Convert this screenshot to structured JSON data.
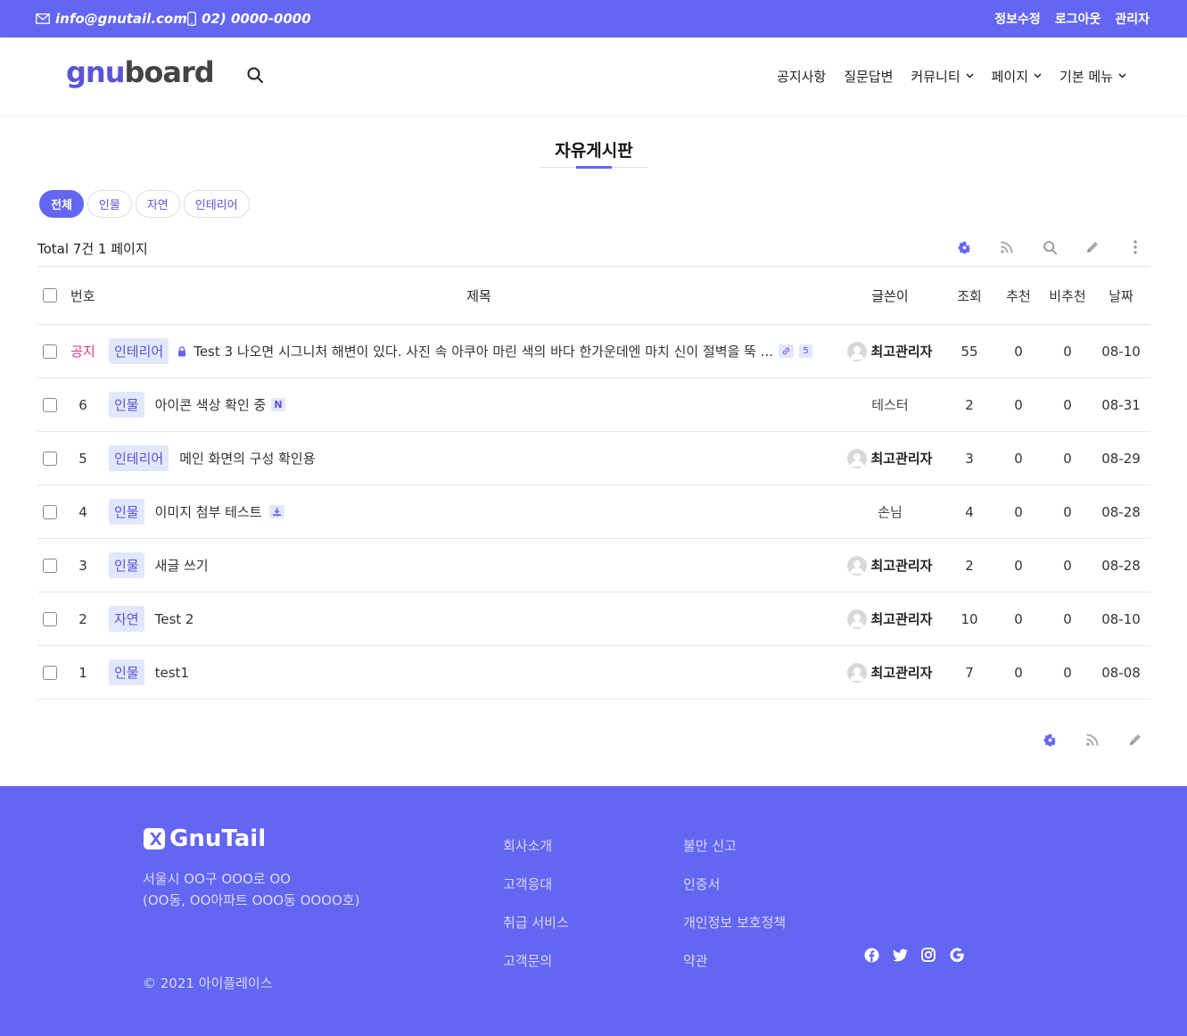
{
  "topbar": {
    "email": "info@gnutail.com",
    "phone": "02) 0000-0000",
    "links": [
      "정보수정",
      "로그아웃",
      "관리자"
    ]
  },
  "header": {
    "logo_part1": "gnu",
    "logo_part2": "board",
    "nav": [
      {
        "label": "공지사항",
        "dropdown": false
      },
      {
        "label": "질문답변",
        "dropdown": false
      },
      {
        "label": "커뮤니티",
        "dropdown": true
      },
      {
        "label": "페이지",
        "dropdown": true
      },
      {
        "label": "기본 메뉴",
        "dropdown": true
      }
    ]
  },
  "board": {
    "title": "자유게시판",
    "categories": [
      "전체",
      "인물",
      "자연",
      "인테리어"
    ],
    "active_category": "전체",
    "total_text": "Total 7건 1 페이지",
    "columns": {
      "num": "번호",
      "subject": "제목",
      "writer": "글쓴이",
      "hit": "조회",
      "good": "추천",
      "nogood": "비추천",
      "date": "날짜"
    },
    "rows": [
      {
        "num": "공지",
        "notice": true,
        "category": "인테리어",
        "subject": "Test 3 나오면 시그니처 해변이 있다. 사진 속 아쿠아 마린 색의 바다 한가운데엔 마치 신이 절벽을 뚝 ...",
        "secret": true,
        "link": true,
        "comments": "5",
        "writer": "최고관리자",
        "avatar": true,
        "hit": "55",
        "good": "0",
        "nogood": "0",
        "date": "08-10"
      },
      {
        "num": "6",
        "category": "인물",
        "subject": "아이콘 색상 확인 중",
        "new_badge": "N",
        "writer": "테스터",
        "avatar": false,
        "hit": "2",
        "good": "0",
        "nogood": "0",
        "date": "08-31"
      },
      {
        "num": "5",
        "category": "인테리어",
        "subject": "메인 화면의 구성 확인용",
        "writer": "최고관리자",
        "avatar": true,
        "hit": "3",
        "good": "0",
        "nogood": "0",
        "date": "08-29"
      },
      {
        "num": "4",
        "category": "인물",
        "subject": "이미지 첨부 테스트",
        "file": true,
        "writer": "손님",
        "avatar": false,
        "hit": "4",
        "good": "0",
        "nogood": "0",
        "date": "08-28"
      },
      {
        "num": "3",
        "category": "인물",
        "subject": "새글 쓰기",
        "writer": "최고관리자",
        "avatar": true,
        "hit": "2",
        "good": "0",
        "nogood": "0",
        "date": "08-28"
      },
      {
        "num": "2",
        "category": "자연",
        "subject": "Test 2",
        "writer": "최고관리자",
        "avatar": true,
        "hit": "10",
        "good": "0",
        "nogood": "0",
        "date": "08-10"
      },
      {
        "num": "1",
        "category": "인물",
        "subject": "test1",
        "writer": "최고관리자",
        "avatar": true,
        "hit": "7",
        "good": "0",
        "nogood": "0",
        "date": "08-08"
      }
    ]
  },
  "footer": {
    "brand": "GnuTail",
    "address_line1": "서울시 OO구 OOO로 OO",
    "address_line2": "(OO동, OO아파트 OOO동 OOOO호)",
    "copyright": "© 2021 아이플레이스",
    "col1": [
      "회사소개",
      "고객응대",
      "취급 서비스",
      "고객문의"
    ],
    "col2": [
      "불만 신고",
      "인증서",
      "개인정보 보호정책",
      "약관"
    ],
    "socials": [
      "facebook-icon",
      "twitter-icon",
      "instagram-icon",
      "google-icon"
    ]
  },
  "colors": {
    "accent": "#6366f1",
    "notice": "#e0367a",
    "category_bg": "#e3e7fb"
  }
}
